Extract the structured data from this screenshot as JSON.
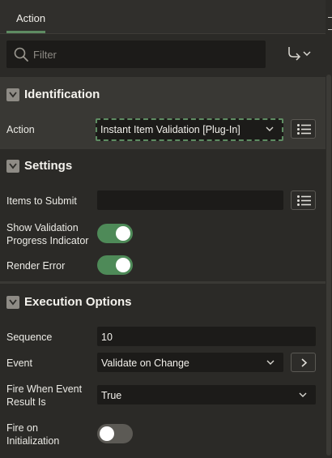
{
  "tabs": [
    {
      "label": "Action",
      "active": true
    }
  ],
  "filter": {
    "placeholder": "Filter",
    "value": ""
  },
  "toolbar": {
    "goto_icon": "go-to-arrow-icon"
  },
  "sections": {
    "identification": {
      "title": "Identification",
      "action_label": "Action",
      "action_value": "Instant Item Validation [Plug-In]"
    },
    "settings": {
      "title": "Settings",
      "items_to_submit_label": "Items to Submit",
      "items_to_submit_value": "",
      "show_progress_label_1": "Show Validation",
      "show_progress_label_2": "Progress Indicator",
      "show_progress_on": true,
      "render_error_label": "Render Error",
      "render_error_on": true
    },
    "execution": {
      "title": "Execution Options",
      "sequence_label": "Sequence",
      "sequence_value": "10",
      "event_label": "Event",
      "event_value": "Validate on Change",
      "fire_when_label_1": "Fire When Event",
      "fire_when_label_2": "Result Is",
      "fire_when_value": "True",
      "fire_init_label_1": "Fire on",
      "fire_init_label_2": "Initialization",
      "fire_init_on": false
    }
  },
  "colors": {
    "accent_green": "#4e8a58",
    "focus_green": "#5e8c62",
    "panel_bg": "#2b2a27",
    "field_bg": "#1c1b19"
  }
}
